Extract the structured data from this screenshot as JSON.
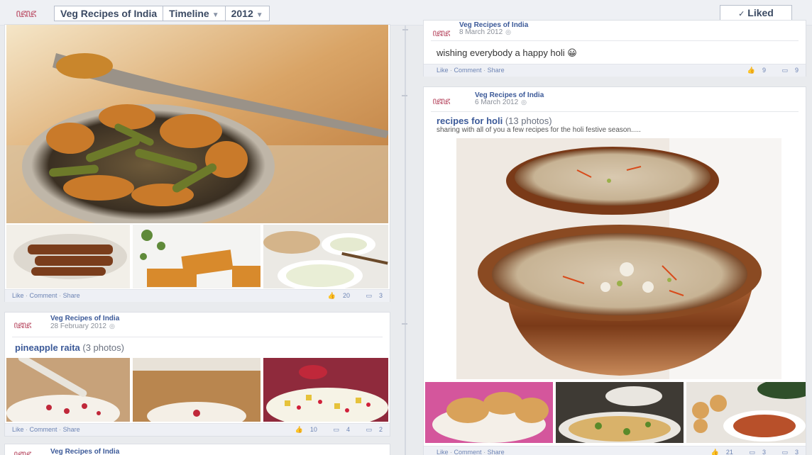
{
  "header": {
    "logo_text": "ꦗꦗ",
    "page_name": "Veg Recipes of India",
    "timeline_label": "Timeline",
    "year_label": "2012",
    "liked_label": "Liked",
    "liked_icon": "check-icon"
  },
  "posts": [
    {
      "id": "left-top",
      "actions": [
        "Like",
        "Comment",
        "Share"
      ],
      "likes": "20",
      "comments": "3"
    },
    {
      "id": "left-pineapple",
      "author": "Veg Recipes of India",
      "date": "28 February 2012",
      "title": "pineapple raita",
      "photo_count": "(3 photos)",
      "actions": [
        "Like",
        "Comment",
        "Share"
      ],
      "likes": "10",
      "shares": "4",
      "comments": "2"
    },
    {
      "id": "left-bottom",
      "author": "Veg Recipes of India"
    },
    {
      "id": "right-holi-greeting",
      "author": "Veg Recipes of India",
      "date": "8 March 2012",
      "text": "wishing everybody a happy holi 😀",
      "actions": [
        "Like",
        "Comment",
        "Share"
      ],
      "likes": "9",
      "comments": "9"
    },
    {
      "id": "right-holi-recipes",
      "author": "Veg Recipes of India",
      "date": "6 March 2012",
      "title": "recipes for holi",
      "photo_count": "(13 photos)",
      "description": "sharing with all of you a few recipes for the holi festive season.....",
      "actions": [
        "Like",
        "Comment",
        "Share"
      ],
      "likes": "21",
      "shares": "3",
      "comments": "3"
    }
  ],
  "colors": {
    "link": "#3b5998",
    "action": "#6d84b4",
    "background": "#e9ebee"
  }
}
